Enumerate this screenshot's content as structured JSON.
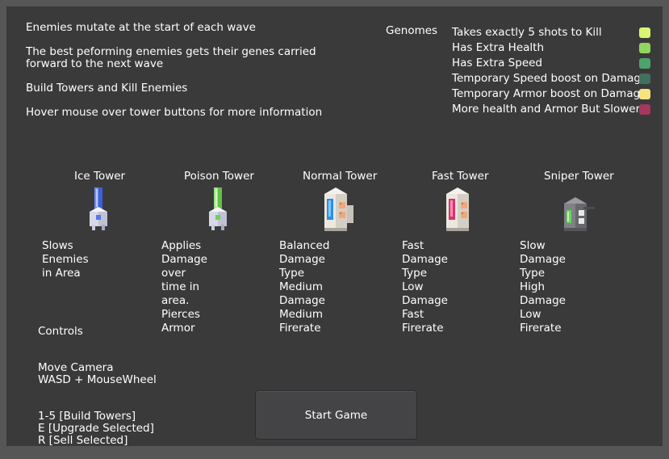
{
  "intro": {
    "line1": "Enemies mutate at the start of each wave",
    "line2": "The best peforming enemies gets their genes carried\nforward to the next wave",
    "line3": "Build Towers and Kill Enemies",
    "line4": "Hover mouse over tower buttons for more information"
  },
  "genomes": {
    "title": "Genomes",
    "items": [
      {
        "label": "Takes exactly 5 shots to Kill",
        "color": "#d8f574"
      },
      {
        "label": "Has Extra Health",
        "color": "#92d561"
      },
      {
        "label": "Has Extra Speed",
        "color": "#4da36b"
      },
      {
        "label": "Temporary Speed boost on Damage",
        "color": "#40715f"
      },
      {
        "label": "Temporary Armor boost on Damage",
        "color": "#f7e281"
      },
      {
        "label": "More health and Armor But Slower",
        "color": "#a5365d"
      }
    ]
  },
  "towers": [
    {
      "name": "Ice Tower",
      "icon": "ice-tower-icon",
      "desc": "Slows Enemies in Area"
    },
    {
      "name": "Poison Tower",
      "icon": "poison-tower-icon",
      "desc": "Applies Damage over\ntime in area. Pierces\nArmor"
    },
    {
      "name": "Normal Tower",
      "icon": "normal-tower-icon",
      "desc": "Balanced Damage Type\nMedium Damage\nMedium Firerate"
    },
    {
      "name": "Fast Tower",
      "icon": "fast-tower-icon",
      "desc": "Fast Damage Type\nLow Damage\nFast Firerate"
    },
    {
      "name": "Sniper Tower",
      "icon": "sniper-tower-icon",
      "desc": "Slow Damage Type\nHigh Damage\nLow Firerate"
    }
  ],
  "controls": {
    "title": "Controls",
    "camera": "Move Camera\nWASD + MouseWheel",
    "keys": "1-5 [Build Towers]\nE [Upgrade Selected]\nR [Sell Selected]"
  },
  "start_button": "Start Game"
}
